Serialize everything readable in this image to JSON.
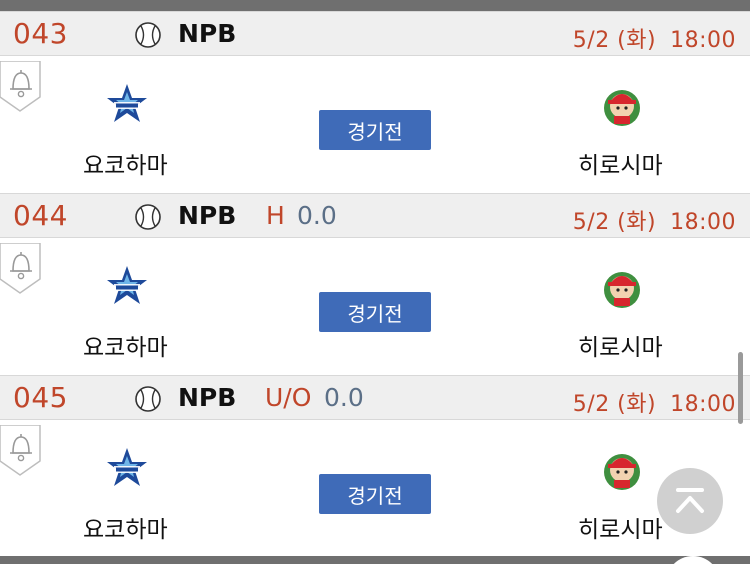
{
  "matches": [
    {
      "number": "043",
      "league": "NPB",
      "bet_type": "",
      "bet_value": "",
      "date": "5/2 (화)",
      "time": "18:00",
      "home_team": "요코하마",
      "away_team": "히로시마",
      "status": "경기전"
    },
    {
      "number": "044",
      "league": "NPB",
      "bet_type": "H",
      "bet_value": "0.0",
      "date": "5/2 (화)",
      "time": "18:00",
      "home_team": "요코하마",
      "away_team": "히로시마",
      "status": "경기전"
    },
    {
      "number": "045",
      "league": "NPB",
      "bet_type": "U/O",
      "bet_value": "0.0",
      "date": "5/2 (화)",
      "time": "18:00",
      "home_team": "요코하마",
      "away_team": "히로시마",
      "status": "경기전"
    }
  ],
  "icons": {
    "sport": "baseball-icon",
    "alert": "bell-icon",
    "home_logo": "baystars-star-logo",
    "away_logo": "carp-mascot-logo",
    "scroll_top": "chevron-up-icon"
  },
  "colors": {
    "match_number": "#c0462a",
    "bet_value": "#5b6f87",
    "status_button": "#3f6bb8",
    "header_bg": "#efefef"
  }
}
